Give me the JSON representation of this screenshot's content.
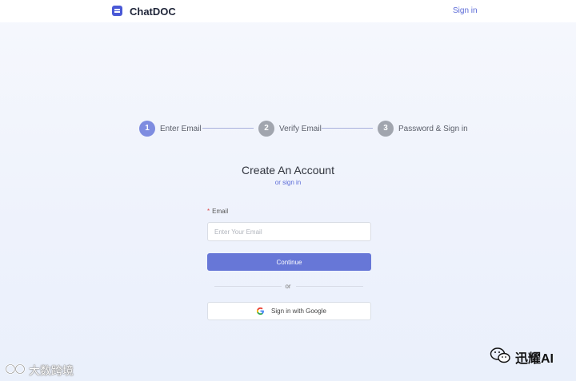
{
  "header": {
    "brand": "ChatDOC",
    "sign_in": "Sign in"
  },
  "steps": [
    {
      "number": "1",
      "label": "Enter Email",
      "state": "active"
    },
    {
      "number": "2",
      "label": "Verify Email",
      "state": "inactive"
    },
    {
      "number": "3",
      "label": "Password & Sign in",
      "state": "inactive"
    }
  ],
  "form": {
    "title": "Create An Account",
    "subtitle_link": "or sign in",
    "email_label": "Email",
    "required_marker": "*",
    "email_placeholder": "Enter Your Email",
    "email_value": "",
    "continue_label": "Continue",
    "divider_text": "or",
    "google_label": "Sign in with Google"
  },
  "watermarks": {
    "left": "大数跨境",
    "right": "迅耀AI"
  },
  "colors": {
    "accent": "#6777d7",
    "link": "#5b6ad7",
    "step_active": "#7e8ce0",
    "step_inactive": "#a1a5ae",
    "brand_icon": "#4a59d6"
  },
  "icons": {
    "brand": "chat-document-icon",
    "google": "google-g-icon",
    "watermark_left": "dashu-logo-icon",
    "watermark_right": "wechat-icon"
  }
}
